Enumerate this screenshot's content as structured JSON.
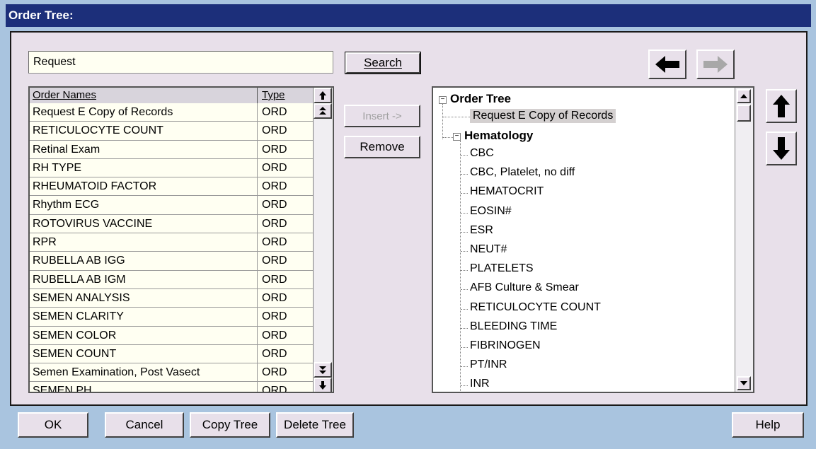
{
  "window": {
    "title": "Order Tree:"
  },
  "search": {
    "value": "Request",
    "button_label": "Search"
  },
  "list": {
    "columns": [
      "Order Names",
      "Type"
    ],
    "rows": [
      {
        "name": "Request E Copy of Records",
        "type": "ORD"
      },
      {
        "name": "RETICULOCYTE COUNT",
        "type": "ORD"
      },
      {
        "name": "Retinal Exam",
        "type": "ORD"
      },
      {
        "name": "RH TYPE",
        "type": "ORD"
      },
      {
        "name": "RHEUMATOID FACTOR",
        "type": "ORD"
      },
      {
        "name": "Rhythm ECG",
        "type": "ORD"
      },
      {
        "name": "ROTOVIRUS VACCINE",
        "type": "ORD"
      },
      {
        "name": "RPR",
        "type": "ORD"
      },
      {
        "name": "RUBELLA AB IGG",
        "type": "ORD"
      },
      {
        "name": "RUBELLA AB IGM",
        "type": "ORD"
      },
      {
        "name": "SEMEN ANALYSIS",
        "type": "ORD"
      },
      {
        "name": "SEMEN CLARITY",
        "type": "ORD"
      },
      {
        "name": "SEMEN COLOR",
        "type": "ORD"
      },
      {
        "name": "SEMEN COUNT",
        "type": "ORD"
      },
      {
        "name": "Semen Examination, Post Vasect",
        "type": "ORD"
      },
      {
        "name": "SEMEN PH",
        "type": "ORD"
      }
    ]
  },
  "actions": {
    "insert_label": "Insert ->",
    "remove_label": "Remove"
  },
  "tree": {
    "root_label": "Order Tree",
    "root_child": "Request E Copy of Records",
    "group_label": "Hematology",
    "group_children": [
      "CBC",
      "CBC, Platelet, no diff",
      "HEMATOCRIT",
      "EOSIN#",
      "ESR",
      "NEUT#",
      "PLATELETS",
      "AFB Culture & Smear",
      "RETICULOCYTE COUNT",
      "BLEEDING TIME",
      "FIBRINOGEN",
      "PT/INR",
      "INR"
    ]
  },
  "footer": {
    "ok_label": "OK",
    "cancel_label": "Cancel",
    "copy_tree_label": "Copy Tree",
    "delete_tree_label": "Delete Tree",
    "help_label": "Help"
  },
  "icons": {
    "back": "arrow-left-icon",
    "forward": "arrow-right-icon",
    "move_up": "arrow-up-icon",
    "move_down": "arrow-down-icon"
  },
  "colors": {
    "title_bar": "#1c2f7a",
    "dialog_bg": "#e8e0ea",
    "outer_bg": "#a9c4df",
    "field_bg": "#fffff2",
    "selected_bg": "#d4d0d0"
  }
}
